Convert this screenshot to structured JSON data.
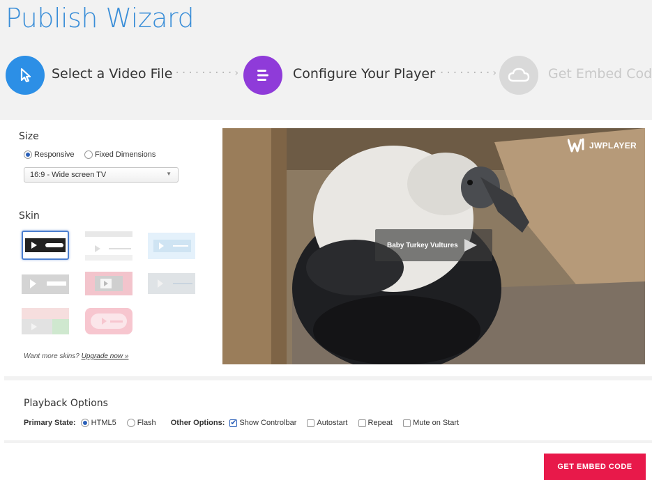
{
  "header": {
    "title": "Publish Wizard",
    "steps": [
      {
        "label": "Select a Video File",
        "icon": "cursor-icon",
        "color": "#2c8fe6",
        "state": "done"
      },
      {
        "label": "Configure Your Player",
        "icon": "list-icon",
        "color": "#8f3bd9",
        "state": "active"
      },
      {
        "label": "Get Embed Code",
        "icon": "cloud-icon",
        "color": "#d9d9d9",
        "state": "upcoming"
      }
    ],
    "separator": "·········›"
  },
  "size": {
    "title": "Size",
    "options": [
      {
        "label": "Responsive",
        "selected": true
      },
      {
        "label": "Fixed Dimensions",
        "selected": false
      }
    ],
    "aspect_value": "16:9 - Wide screen TV"
  },
  "skin": {
    "title": "Skin",
    "selected_index": 0,
    "upsell_text": "Want more skins?",
    "upsell_link": "Upgrade now »"
  },
  "player": {
    "video_title": "Baby Turkey Vultures",
    "logo_text": "JWPLAYER"
  },
  "playback": {
    "title": "Playback Options",
    "primary_state_label": "Primary State:",
    "primary_options": [
      {
        "label": "HTML5",
        "selected": true
      },
      {
        "label": "Flash",
        "selected": false
      }
    ],
    "other_options_label": "Other Options:",
    "other_options": [
      {
        "label": "Show Controlbar",
        "checked": true
      },
      {
        "label": "Autostart",
        "checked": false
      },
      {
        "label": "Repeat",
        "checked": false
      },
      {
        "label": "Mute on Start",
        "checked": false
      }
    ]
  },
  "actions": {
    "embed_button": "GET EMBED CODE"
  },
  "colors": {
    "title_blue": "#3a8ed8",
    "accent_red": "#e8194a",
    "radio_blue": "#2a5fb8"
  }
}
